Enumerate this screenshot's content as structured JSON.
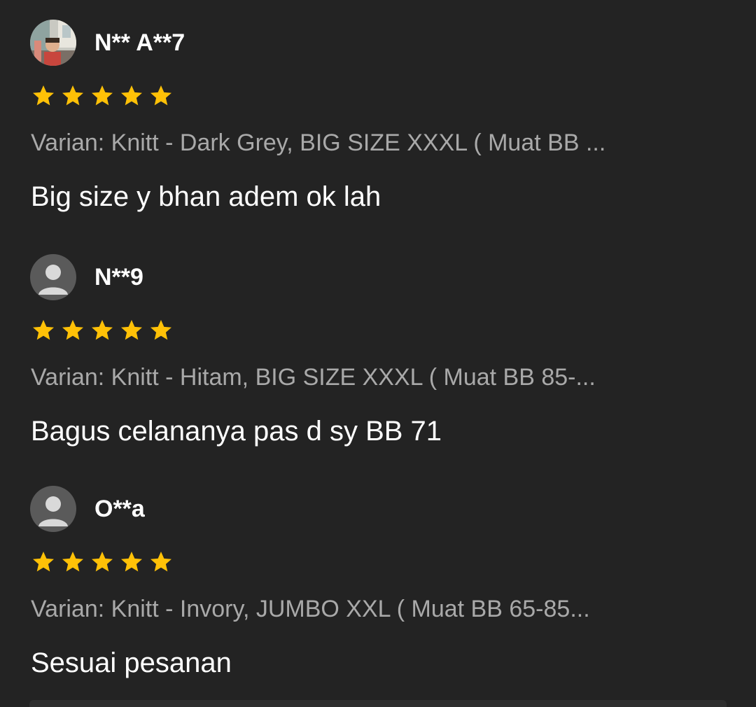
{
  "reviews": [
    {
      "username": "N** A**7",
      "avatar": "photo-avatar",
      "rating": 5,
      "variant": "Varian: Knitt - Dark Grey, BIG SIZE XXXL ( Muat BB ...",
      "comment": "Big size y bhan adem ok lah"
    },
    {
      "username": "N**9",
      "avatar": "default-user-icon",
      "rating": 5,
      "variant": "Varian: Knitt - Hitam, BIG SIZE XXXL ( Muat BB 85-...",
      "comment": "Bagus celananya pas d sy BB 71"
    },
    {
      "username": "O**a",
      "avatar": "default-user-icon",
      "rating": 5,
      "variant": "Varian: Knitt - Invory, JUMBO XXL ( Muat BB 65-85...",
      "comment": "Sesuai pesanan"
    }
  ],
  "colors": {
    "background": "#232323",
    "star": "#FFC107",
    "variant_text": "#A9A9A9",
    "text": "#FFFFFF",
    "default_avatar_bg": "#5A5A5A",
    "default_avatar_fg": "#D9D9D9"
  }
}
